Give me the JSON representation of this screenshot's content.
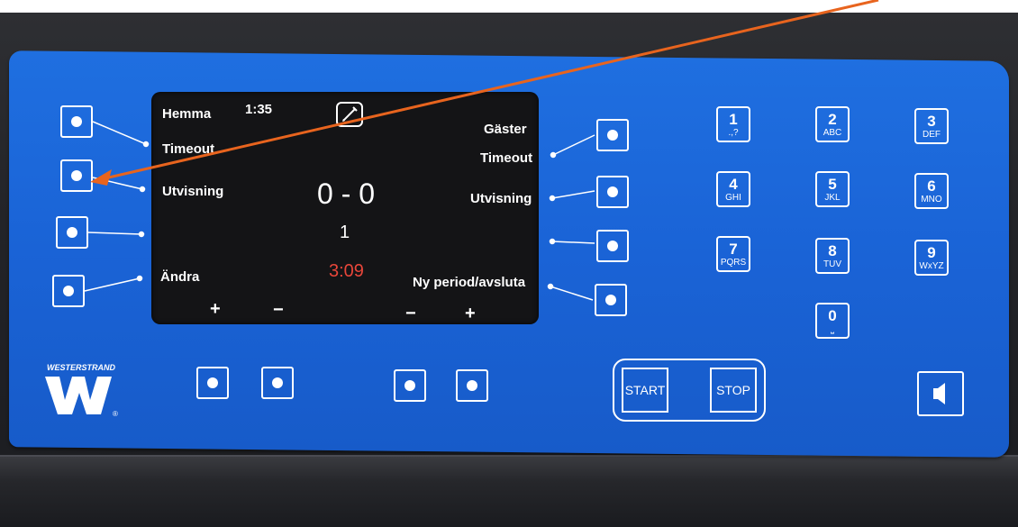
{
  "screen": {
    "home_label": "Hemma",
    "away_label": "Gäster",
    "clock": "1:35",
    "timeout_left": "Timeout",
    "timeout_right": "Timeout",
    "penalty_left": "Utvisning",
    "penalty_right": "Utvisning",
    "score": "0 - 0",
    "period": "1",
    "period_time": "3:09",
    "change_label": "Ändra",
    "new_period_label": "Ny period/avsluta",
    "plus_left": "+",
    "minus_left": "−",
    "minus_right": "−",
    "plus_right": "+"
  },
  "keypad": [
    {
      "num": "1",
      "sub": ".,?"
    },
    {
      "num": "2",
      "sub": "ABC"
    },
    {
      "num": "3",
      "sub": "DEF"
    },
    {
      "num": "4",
      "sub": "GHI"
    },
    {
      "num": "5",
      "sub": "JKL"
    },
    {
      "num": "6",
      "sub": "MNO"
    },
    {
      "num": "7",
      "sub": "PQRS"
    },
    {
      "num": "8",
      "sub": "TUV"
    },
    {
      "num": "9",
      "sub": "WxYZ"
    },
    {
      "num": "0",
      "sub": "⎵"
    }
  ],
  "controls": {
    "start_label": "START",
    "stop_label": "STOP"
  },
  "brand": {
    "name": "WESTERSTRAND",
    "mark": "®"
  },
  "colors": {
    "panel_blue": "#1a63d6",
    "annotation_arrow": "#e8641e",
    "period_time_red": "#e8463a"
  }
}
